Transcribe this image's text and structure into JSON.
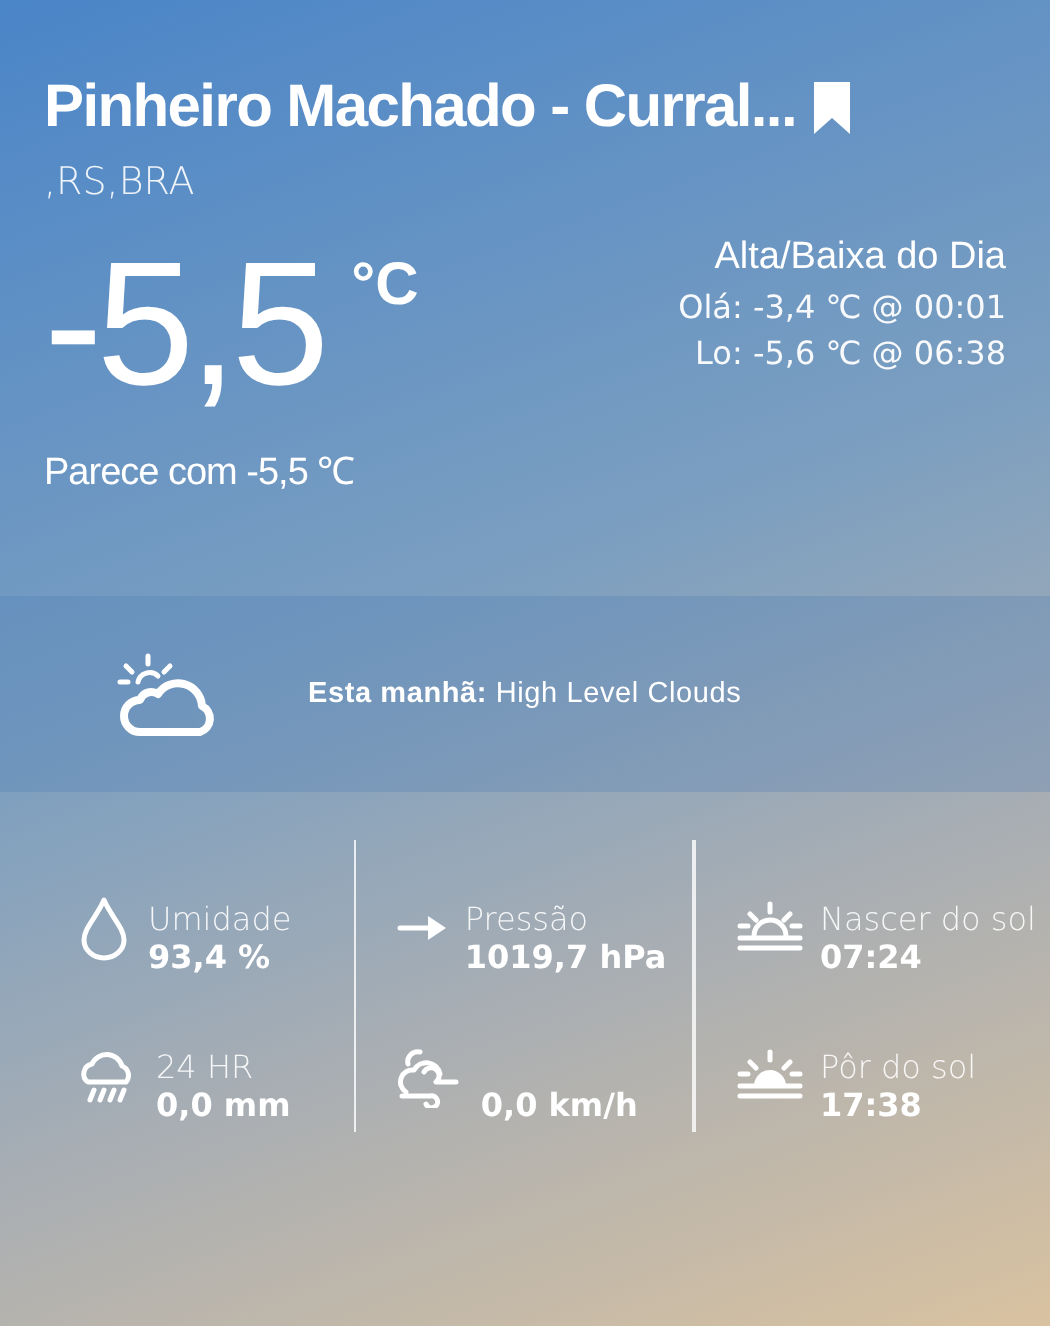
{
  "location": {
    "title": "Pinheiro Machado - Curral...",
    "subtitle": ",RS,BRA",
    "bookmarked": true
  },
  "current": {
    "temperature": "-5,5",
    "unit": "°C",
    "feels_like": "Parece com -5,5 ℃"
  },
  "daily": {
    "title": "Alta/Baixa do Dia",
    "high": "Olá: -3,4 ℃ @ 00:01",
    "low": "Lo: -5,6 ℃ @ 06:38"
  },
  "forecast": {
    "text": "**Esta manhã:** High Level Clouds"
  },
  "stats": [
    {
      "items": [
        {
          "kind": "humidity",
          "label": "Umidade",
          "value": "93,4 %"
        },
        {
          "kind": "rain",
          "label": "24 HR",
          "value": "0,0 mm"
        }
      ]
    },
    {
      "items": [
        {
          "kind": "pressure",
          "label": "Pressão",
          "value": "1019,7 hPa"
        },
        {
          "kind": "wind",
          "value": "0,0 km/h"
        }
      ]
    },
    {
      "items": [
        {
          "kind": "sunrise",
          "label": "Nascer do sol",
          "value": "07:24"
        },
        {
          "kind": "sunset",
          "label": "Pôr do sol",
          "value": "17:38"
        }
      ]
    }
  ]
}
